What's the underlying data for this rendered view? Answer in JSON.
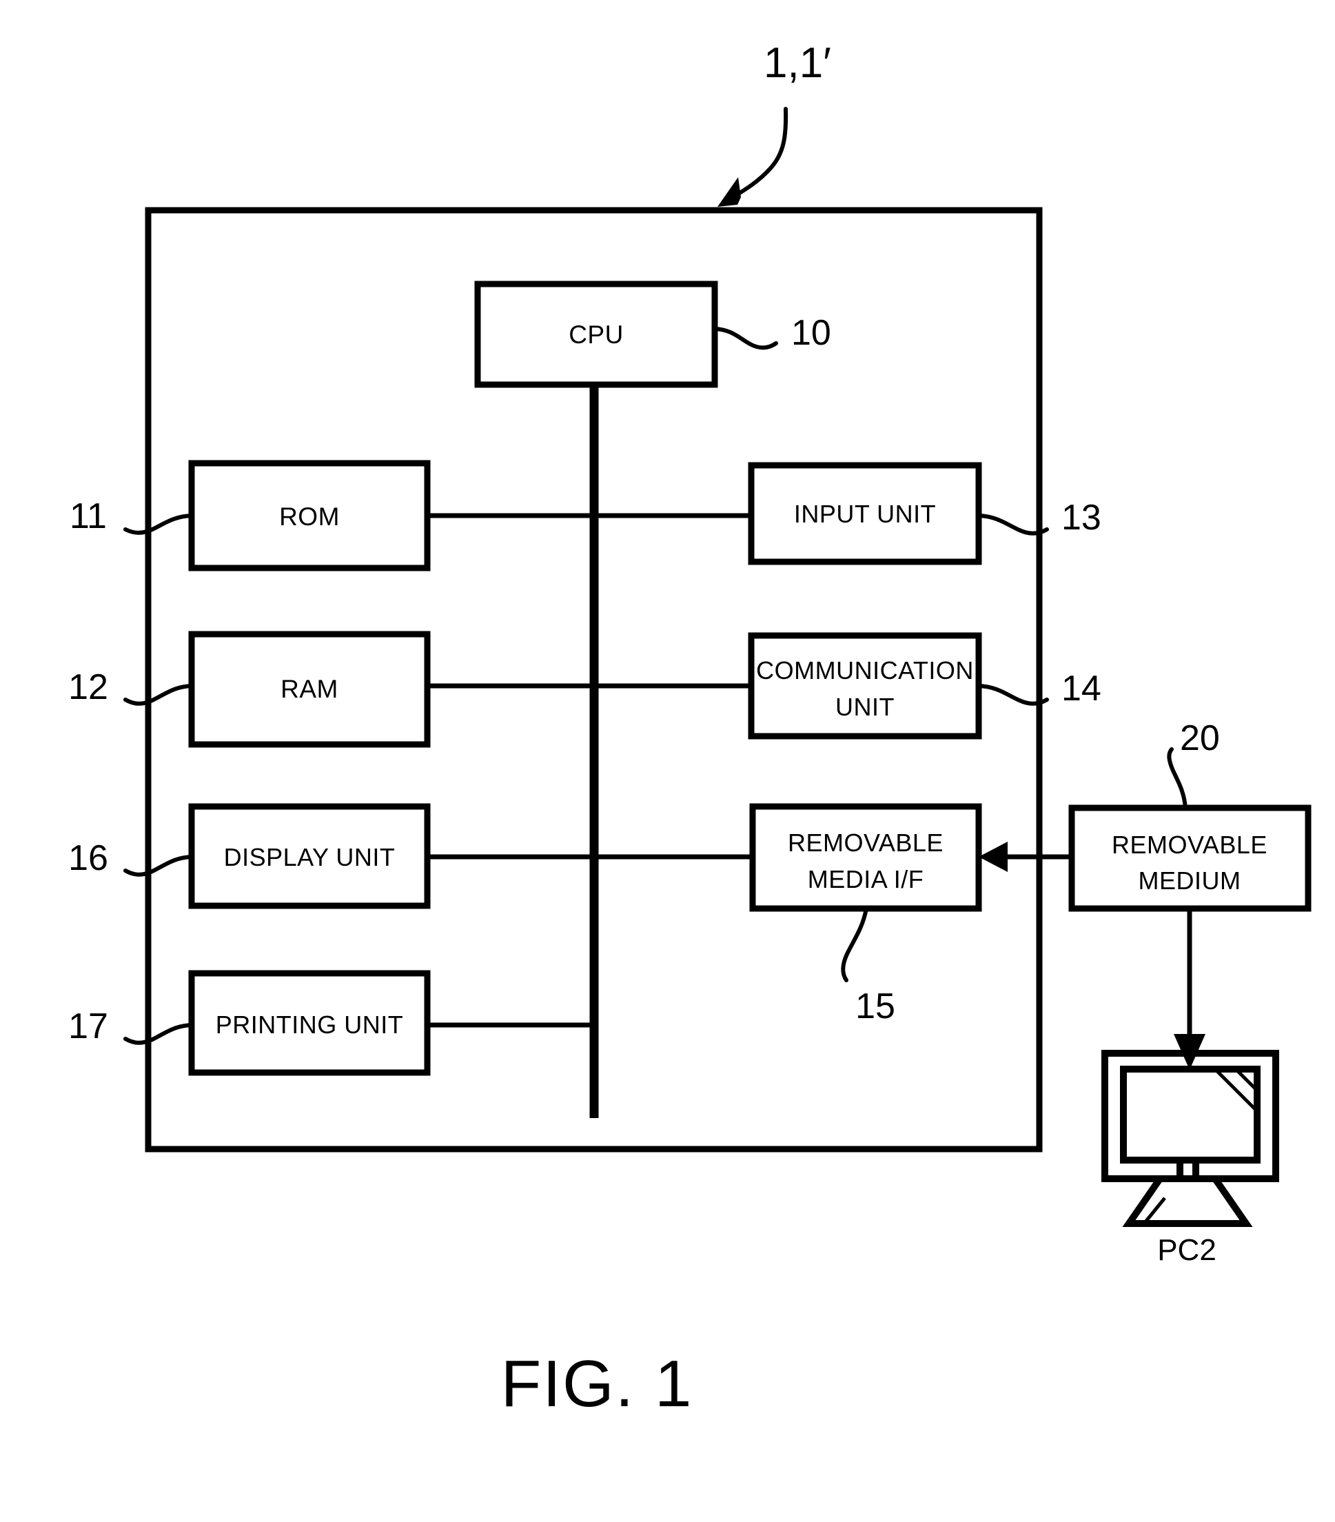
{
  "figure": {
    "caption": "FIG. 1",
    "assembly_ref": "1,1′"
  },
  "system_boundary": {
    "name": "information-processing-apparatus"
  },
  "blocks": [
    {
      "id": "cpu",
      "label": "CPU",
      "label2": "",
      "ref": "10"
    },
    {
      "id": "rom",
      "label": "ROM",
      "label2": "",
      "ref": "11"
    },
    {
      "id": "ram",
      "label": "RAM",
      "label2": "",
      "ref": "12"
    },
    {
      "id": "input-unit",
      "label": "INPUT UNIT",
      "label2": "",
      "ref": "13"
    },
    {
      "id": "communication-unit",
      "label": "COMMUNICATION",
      "label2": "UNIT",
      "ref": "14"
    },
    {
      "id": "removable-media-if",
      "label": "REMOVABLE",
      "label2": "MEDIA I/F",
      "ref": "15"
    },
    {
      "id": "display-unit",
      "label": "DISPLAY UNIT",
      "label2": "",
      "ref": "16"
    },
    {
      "id": "printing-unit",
      "label": "PRINTING UNIT",
      "label2": "",
      "ref": "17"
    },
    {
      "id": "removable-medium",
      "label": "REMOVABLE",
      "label2": "MEDIUM",
      "ref": "20"
    }
  ],
  "external": {
    "pc_label": "PC2"
  },
  "colors": {
    "ink": "#000000",
    "paper": "#ffffff"
  }
}
